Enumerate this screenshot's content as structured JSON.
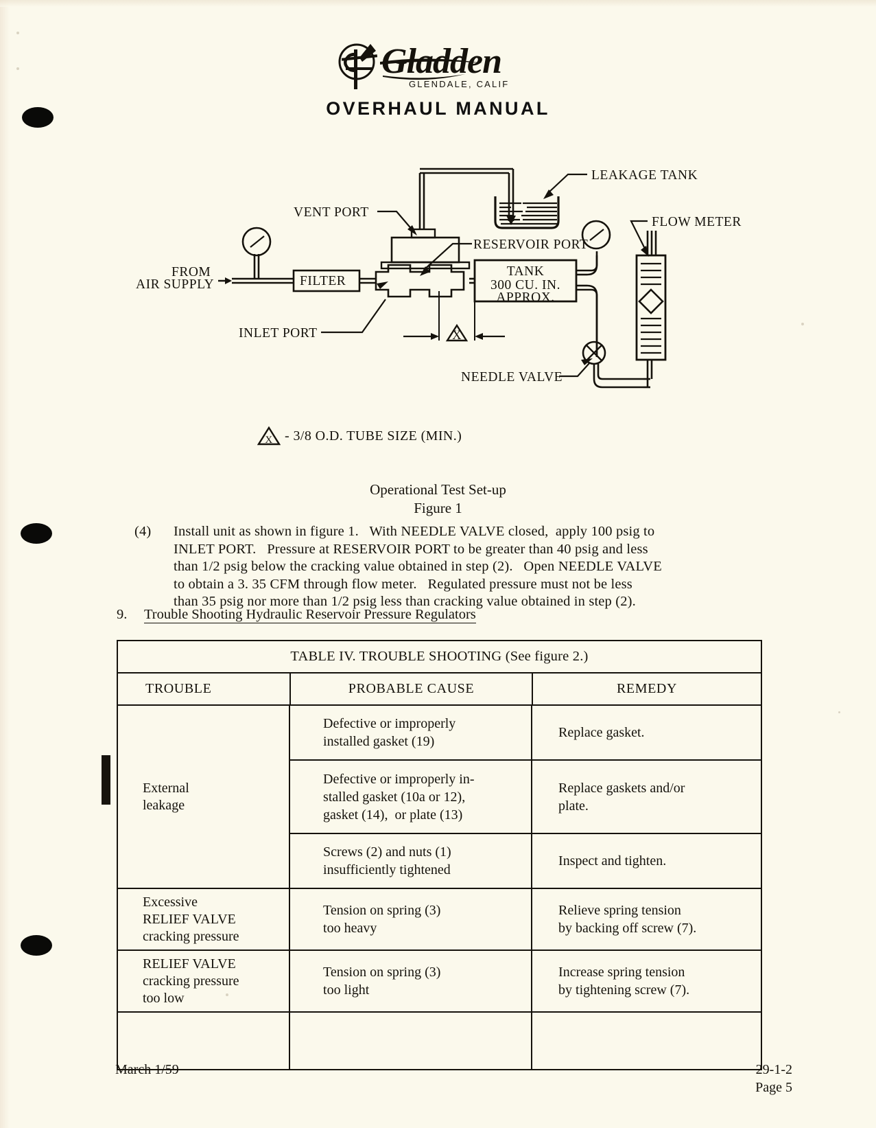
{
  "header": {
    "brand": "Gladden",
    "brand_sub": "GLENDALE, CALIF",
    "title": "OVERHAUL MANUAL"
  },
  "figure": {
    "labels": {
      "from_air_supply_l1": "FROM",
      "from_air_supply_l2": "AIR SUPPLY",
      "filter": "FILTER",
      "vent_port": "VENT PORT",
      "inlet_port": "INLET PORT",
      "reservoir_port": "RESERVOIR PORT",
      "leakage_tank": "LEAKAGE TANK",
      "flow_meter": "FLOW METER",
      "needle_valve": "NEEDLE VALVE",
      "tank_l1": "TANK",
      "tank_l2": "300 CU. IN.",
      "tank_l3": "APPROX.",
      "callout_x": "X"
    },
    "note": "- 3/8 O.D.  TUBE SIZE (MIN.)",
    "note_symbol": "X",
    "caption_l1": "Operational Test Set-up",
    "caption_l2": "Figure 1"
  },
  "paragraph": {
    "number": "(4)",
    "lines": [
      "Install unit as shown in figure 1.   With NEEDLE VALVE closed,  apply 100 psig to",
      "INLET PORT.   Pressure at RESERVOIR PORT to be greater than 40 psig and less",
      "than 1/2 psig below the cracking value obtained in step (2).   Open NEEDLE VALVE",
      "to obtain a 3. 35 CFM through flow meter.   Regulated pressure must not be less",
      "than 35 psig nor more than 1/2 psig less than cracking value obtained in step (2)."
    ]
  },
  "section": {
    "number": "9.",
    "title": "Trouble Shooting Hydraulic Reservoir Pressure Regulators"
  },
  "table": {
    "title": "TABLE IV.   TROUBLE SHOOTING (See figure 2.)",
    "columns": [
      "TROUBLE",
      "PROBABLE CAUSE",
      "REMEDY"
    ],
    "groups": [
      {
        "trouble": "External\nleakage",
        "trouble_l1": "External",
        "trouble_l2": "leakage",
        "rows": [
          {
            "cause_l1": "Defective or improperly",
            "cause_l2": "installed gasket (19)",
            "cause_l3": "",
            "remedy_l1": "Replace gasket.",
            "remedy_l2": ""
          },
          {
            "cause_l1": "Defective or improperly in-",
            "cause_l2": "stalled gasket (10a or 12),",
            "cause_l3": "gasket (14),  or plate (13)",
            "remedy_l1": "Replace gaskets and/or",
            "remedy_l2": "plate."
          },
          {
            "cause_l1": "Screws (2) and nuts (1)",
            "cause_l2": "insufficiently tightened",
            "cause_l3": "",
            "remedy_l1": "Inspect and tighten.",
            "remedy_l2": ""
          }
        ]
      },
      {
        "trouble_l1": "Excessive",
        "trouble_l2": "RELIEF VALVE",
        "trouble_l3": "cracking pressure",
        "rows": [
          {
            "cause_l1": "Tension on spring (3)",
            "cause_l2": "too heavy",
            "cause_l3": "",
            "remedy_l1": "Relieve spring tension",
            "remedy_l2": "by backing off screw (7)."
          }
        ]
      },
      {
        "trouble_l1": "RELIEF VALVE",
        "trouble_l2": "cracking pressure",
        "trouble_l3": "too low",
        "rows": [
          {
            "cause_l1": "Tension on spring (3)",
            "cause_l2": "too light",
            "cause_l3": "",
            "remedy_l1": "Increase spring tension",
            "remedy_l2": "by tightening screw (7)."
          }
        ]
      },
      {
        "trouble_l1": "",
        "trouble_l2": "",
        "trouble_l3": "",
        "rows": [
          {
            "cause_l1": "",
            "cause_l2": "",
            "cause_l3": "",
            "remedy_l1": "",
            "remedy_l2": ""
          }
        ]
      }
    ]
  },
  "footer": {
    "date": "March 1/59",
    "doc_number": "29-1-2",
    "page": "Page 5"
  }
}
